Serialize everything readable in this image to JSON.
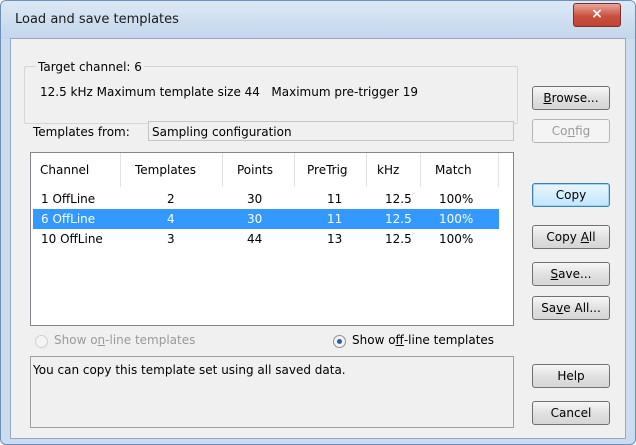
{
  "window": {
    "title": "Load and save templates",
    "close_glyph": "×"
  },
  "target": {
    "legend": "Target channel: 6",
    "rate": "12.5 kHz",
    "max_size_label": "Maximum template size",
    "max_size_value": "44",
    "max_pretrig_label": "Maximum pre-trigger",
    "max_pretrig_value": "19"
  },
  "templates_from": {
    "label": "Templates from:",
    "value": "Sampling configuration"
  },
  "buttons": {
    "browse": {
      "pre": "",
      "key": "B",
      "post": "rowse..."
    },
    "config": {
      "pre": "Co",
      "key": "n",
      "post": "fig"
    },
    "copy": "Copy",
    "copy_all": {
      "pre": "Copy ",
      "key": "A",
      "post": "ll"
    },
    "save": {
      "pre": "",
      "key": "S",
      "post": "ave..."
    },
    "save_all": {
      "pre": "Sa",
      "key": "v",
      "post": "e All..."
    },
    "help": "Help",
    "cancel": "Cancel"
  },
  "table": {
    "columns": [
      "Channel",
      "Templates",
      "Points",
      "PreTrig",
      "kHz",
      "Match"
    ],
    "rows": [
      {
        "channel": "1 OffLine",
        "templates": "2",
        "points": "30",
        "pretrig": "11",
        "khz": "12.5",
        "match": "100%"
      },
      {
        "channel": "6 OffLine",
        "templates": "4",
        "points": "30",
        "pretrig": "11",
        "khz": "12.5",
        "match": "100%"
      },
      {
        "channel": "10 OffLine",
        "templates": "3",
        "points": "44",
        "pretrig": "13",
        "khz": "12.5",
        "match": "100%"
      }
    ],
    "selected_index": 1
  },
  "radios": {
    "online": {
      "pre": "Show o",
      "key": "n",
      "post": "-line templates",
      "checked": false,
      "enabled": false
    },
    "offline": {
      "pre": "Show o",
      "key": "f",
      "post": "f-line templates",
      "checked": true,
      "enabled": true
    }
  },
  "status": {
    "message": "You can copy this template set using all saved data."
  },
  "colors": {
    "selection": "#3399ff",
    "close": "#c9503f",
    "disabled_text": "#9a9a9a",
    "window_frame": "#cbdcef"
  }
}
